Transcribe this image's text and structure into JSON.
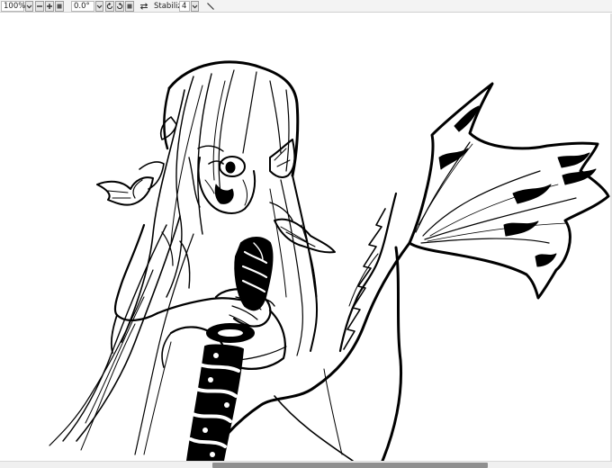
{
  "toolbar": {
    "zoom_value": "100%",
    "angle_value": "0.0°",
    "stabilizer_label": "Stabilizer",
    "stabilizer_value": "4",
    "icons": {
      "zoom_dropdown": "chevron-down-icon",
      "zoom_out": "minus-icon",
      "zoom_in": "plus-icon",
      "fit": "square-icon",
      "angle_dropdown": "chevron-down-icon",
      "rotate_left": "rotate-left-icon",
      "rotate_right": "rotate-right-icon",
      "reset_rotation": "square-icon",
      "flip": "flip-icon",
      "stabilizer_dropdown": "chevron-down-icon",
      "brush_tool": "pen-icon"
    }
  },
  "canvas": {
    "artwork": "line-art-mermaid",
    "background": "#ffffff"
  },
  "colors": {
    "ink": "#000000",
    "toolbar_bg": "#f3f3f3",
    "scroll_thumb": "#8f8f8f"
  }
}
